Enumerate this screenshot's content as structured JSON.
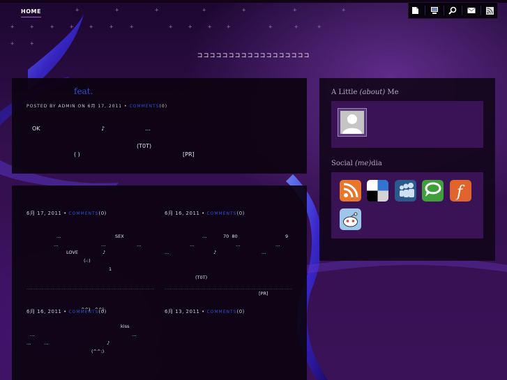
{
  "nav": {
    "home": "HOME"
  },
  "site": {
    "title": "ココココココココココココココココココ"
  },
  "top_post": {
    "title": "feat.",
    "meta_prefix": "POSTED BY ADMIN ON 6月 17, 2011 •",
    "comments": "COMMENTS",
    "comments_count": "(0)",
    "line1a": "OK",
    "line1b": "♪",
    "line1c": "…",
    "line2": "(T0T)",
    "line3a": "( )",
    "line3b": "[PR]"
  },
  "grid_posts": [
    {
      "date": "6月 17, 2011 •",
      "comments": "COMMENTS",
      "count": "(0)",
      "lines": [
        "…",
        "SEX",
        "…",
        "…",
        "…",
        "LOVE",
        "♪",
        "(-:)",
        "1"
      ]
    },
    {
      "date": "6月 16, 2011 •",
      "comments": "COMMENTS",
      "count": "(0)",
      "lines": [
        "…",
        "70  80",
        "9",
        "…",
        "…",
        "…",
        "♪",
        "…",
        "…",
        "(T0T)",
        "[PR]"
      ]
    },
    {
      "date": "6月 16, 2011 •",
      "comments": "COMMENTS",
      "count": "(0)",
      "overlap": "^^)   ^^)",
      "lines": [
        "kiss",
        "…",
        "…",
        "…",
        "…",
        "♪",
        "(^^:)"
      ]
    },
    {
      "date": "6月 13, 2011 •",
      "comments": "COMMENTS",
      "count": "(0)"
    }
  ],
  "sidebar": {
    "about_pre": "A Little ",
    "about_em": "(about)",
    "about_post": " Me",
    "social_pre": "Social ",
    "social_em": "(me)",
    "social_post": "dia"
  },
  "icons": {
    "toolbar": [
      "page-icon",
      "monitor-icon",
      "search-icon",
      "mail-icon",
      "rss-icon"
    ],
    "social": [
      "rss-icon",
      "delicious-icon",
      "myspace-icon",
      "technorati-icon",
      "friendfeed-icon",
      "reddit-icon"
    ]
  },
  "colors": {
    "link": "#3350d8",
    "accent_box": "#3a1357"
  }
}
